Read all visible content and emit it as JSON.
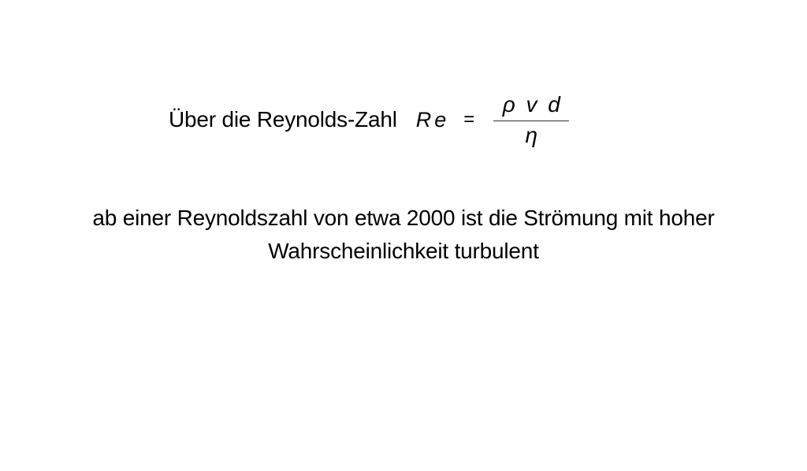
{
  "line1": {
    "text": "Über die Reynolds-Zahl",
    "formula": {
      "lhs": "Re",
      "operator": "=",
      "numerator": "ρ v d",
      "denominator": "η"
    }
  },
  "paragraph": {
    "line_a": "ab einer Reynoldszahl von etwa 2000 ist die Strömung mit hoher",
    "line_b": "Wahrscheinlichkeit turbulent"
  }
}
